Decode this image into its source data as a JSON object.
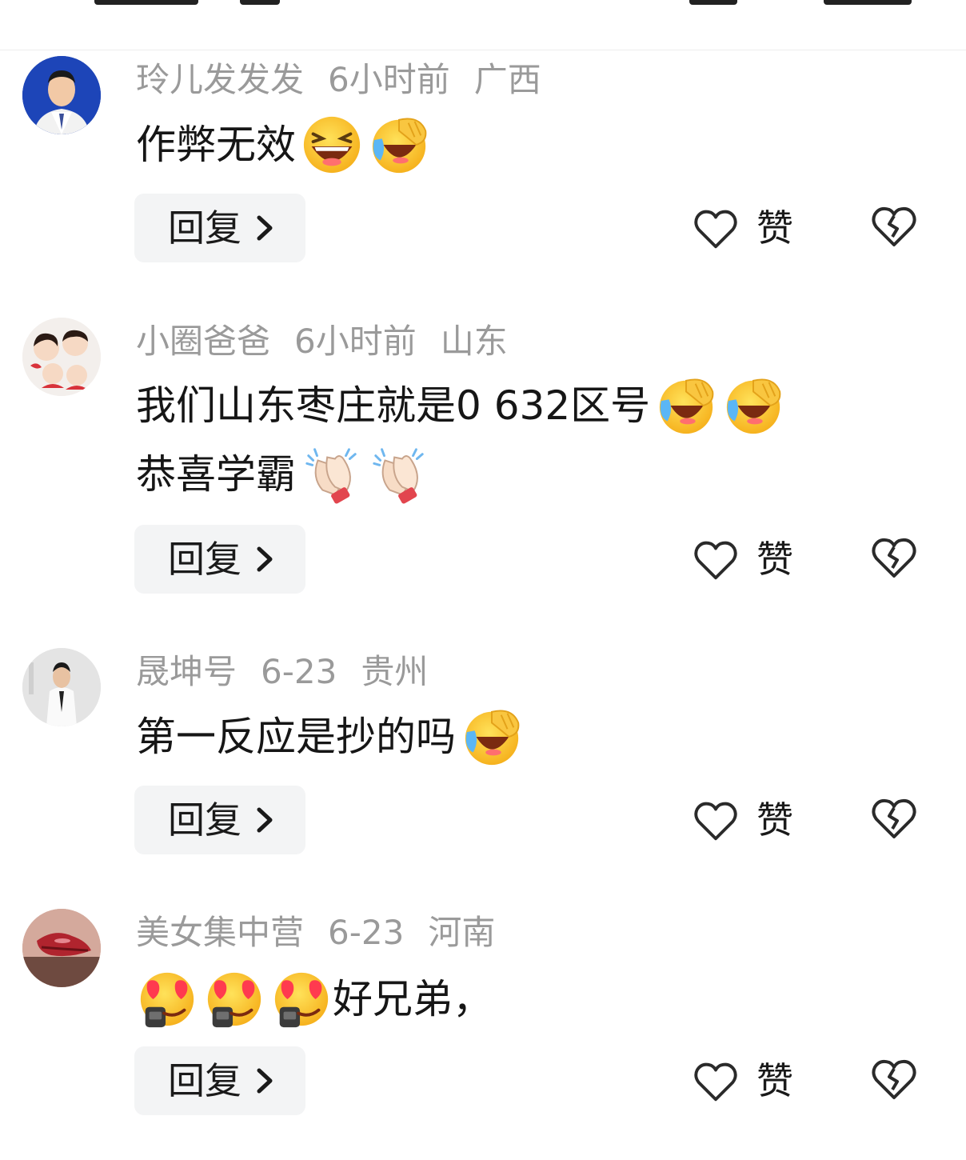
{
  "comments": [
    {
      "username": "玲儿发发发",
      "time": "6小时前",
      "region": "广西",
      "line1": "作弊无效",
      "line2": "",
      "emojis1": [
        "laughing-emoji",
        "crying-laughing-emoji"
      ],
      "emojis2": [],
      "reply_label": "回复",
      "like_label": "赞"
    },
    {
      "username": "小圈爸爸",
      "time": "6小时前",
      "region": "山东",
      "line1": "我们山东枣庄就是0 632区号",
      "line2": "恭喜学霸",
      "emojis1": [
        "crying-laughing-emoji",
        "crying-laughing-emoji"
      ],
      "emojis2": [
        "clapping-emoji",
        "clapping-emoji"
      ],
      "reply_label": "回复",
      "like_label": "赞"
    },
    {
      "username": "晟坤号",
      "time": "6-23",
      "region": "贵州",
      "line1": "第一反应是抄的吗",
      "line2": "",
      "emojis1": [
        "crying-laughing-emoji"
      ],
      "emojis2": [],
      "reply_label": "回复",
      "like_label": "赞"
    },
    {
      "username": "美女集中营",
      "time": "6-23",
      "region": "河南",
      "line1": "好兄弟，",
      "line2": "",
      "emojis1": [],
      "emojis2": [],
      "leading_emojis": [
        "heart-eyes-emoji",
        "heart-eyes-emoji",
        "heart-eyes-emoji"
      ],
      "reply_label": "回复",
      "like_label": "赞"
    }
  ]
}
